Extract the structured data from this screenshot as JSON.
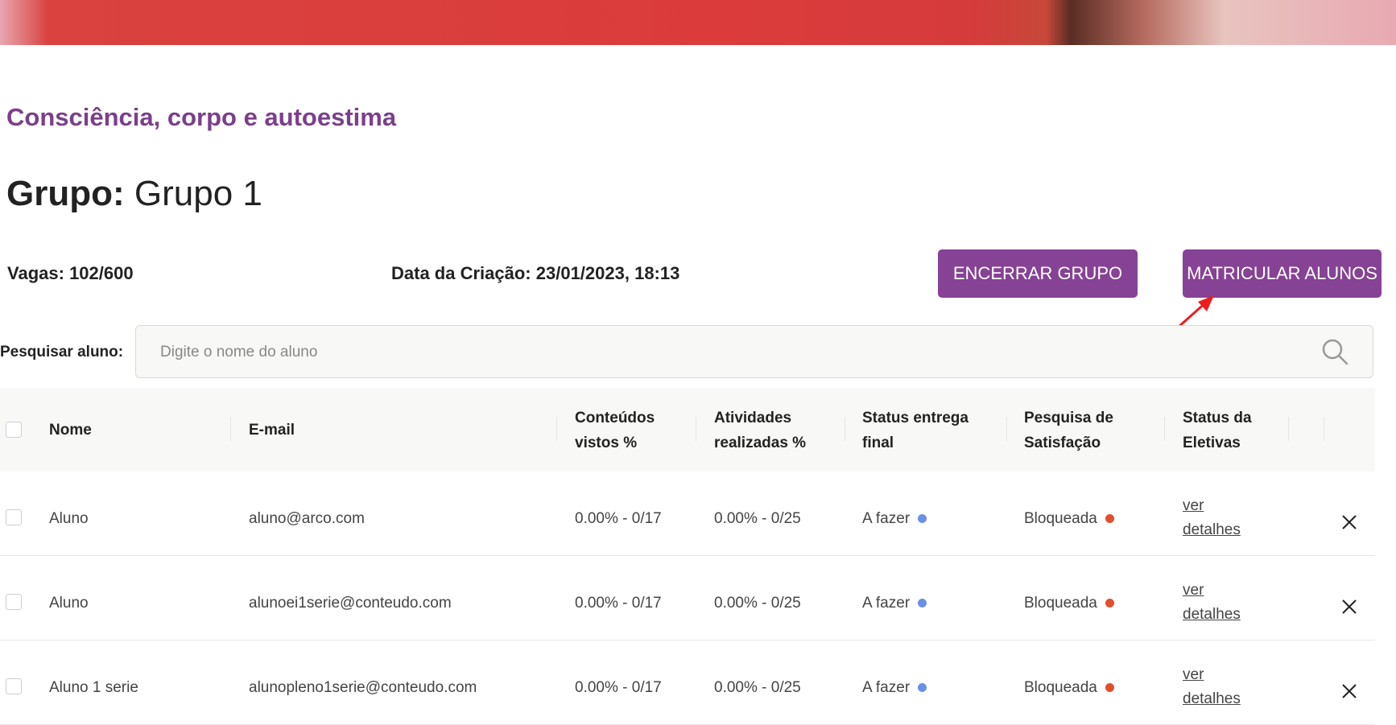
{
  "course_title": "Consciência, corpo e autoestima",
  "group": {
    "label": "Grupo:",
    "name": "Grupo 1"
  },
  "info": {
    "vagas_label": "Vagas:",
    "vagas_value": "102/600",
    "date_label": "Data da Criação:",
    "date_value": "23/01/2023, 18:13"
  },
  "actions": {
    "end_group": "ENCERRAR GRUPO",
    "enroll_students": "MATRICULAR ALUNOS"
  },
  "search": {
    "label": "Pesquisar aluno:",
    "placeholder": "Digite o nome do aluno",
    "value": ""
  },
  "table": {
    "headers": {
      "nome": "Nome",
      "email": "E-mail",
      "conteudos_1": "Conteúdos",
      "conteudos_2": "vistos %",
      "atividades_1": "Atividades",
      "atividades_2": "realizadas %",
      "status_entrega_1": "Status entrega",
      "status_entrega_2": "final",
      "pesquisa_1": "Pesquisa de",
      "pesquisa_2": "Satisfação",
      "eletivas_1": "Status da",
      "eletivas_2": "Eletivas"
    },
    "rows": [
      {
        "name": "Aluno",
        "email": "aluno@arco.com",
        "conteudos": "0.00% - 0/17",
        "atividades": "0.00% - 0/25",
        "status_entrega": "A fazer",
        "pesquisa": "Bloqueada",
        "link_1": "ver",
        "link_2": "detalhes"
      },
      {
        "name": "Aluno",
        "email": "alunoei1serie@conteudo.com",
        "conteudos": "0.00% - 0/17",
        "atividades": "0.00% - 0/25",
        "status_entrega": "A fazer",
        "pesquisa": "Bloqueada",
        "link_1": "ver",
        "link_2": "detalhes"
      },
      {
        "name": "Aluno 1 serie",
        "email": "alunopleno1serie@conteudo.com",
        "conteudos": "0.00% - 0/17",
        "atividades": "0.00% - 0/25",
        "status_entrega": "A fazer",
        "pesquisa": "Bloqueada",
        "link_1": "ver",
        "link_2": "detalhes"
      }
    ]
  },
  "colors": {
    "accent": "#864295",
    "title": "#7b3f8c",
    "status_todo": "#6b8fe6",
    "status_blocked": "#e0502e",
    "annotation_arrow": "#ee1c1c"
  }
}
